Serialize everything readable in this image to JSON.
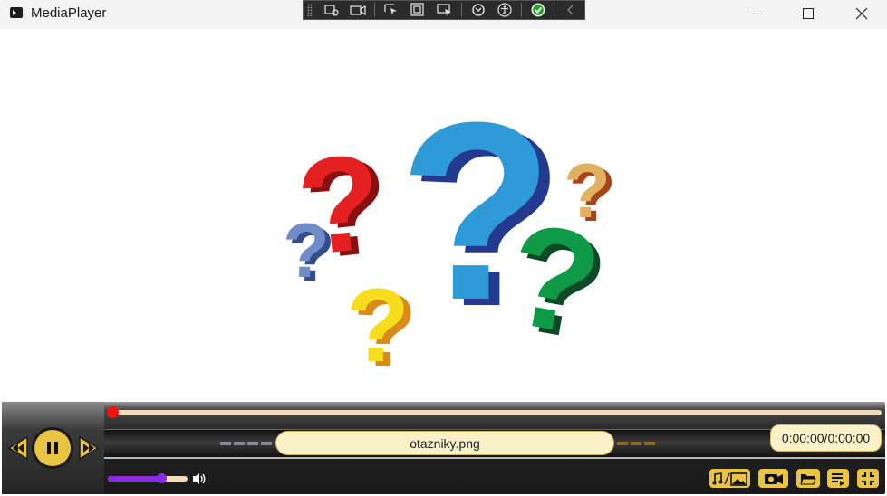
{
  "window": {
    "title": "MediaPlayer",
    "minimize_icon": "minimize-icon",
    "maximize_icon": "maximize-icon",
    "close_icon": "close-icon"
  },
  "dev_toolbar": {
    "icons": [
      "select-element-icon",
      "video-record-icon",
      "pointer-icon",
      "frame-icon",
      "screen-pointer-icon",
      "hot-reload-icon",
      "accessibility-icon",
      "check-icon",
      "chevron-left-icon"
    ]
  },
  "stage": {
    "image_description_icon": "question-marks-image"
  },
  "player": {
    "filename": "otazniky.png",
    "time": "0:00:00/0:00:00",
    "seek_position": 0,
    "volume": 0.67,
    "buttons": {
      "prev_icon": "rewind-icon",
      "play_icon": "pause-icon",
      "next_icon": "fast-forward-icon",
      "volume_icon": "speaker-icon",
      "media_icon": "music-image-icon",
      "camera_icon": "camera-icon",
      "folder_icon": "folder-open-icon",
      "playlist_icon": "playlist-icon",
      "fullscreen_icon": "exit-fullscreen-icon"
    },
    "colors": {
      "accent": "#e9c342",
      "seek_thumb": "#ff1010",
      "volume": "#8a2be2",
      "track": "#f3dcb7",
      "label_bg": "#fbf1c9"
    }
  }
}
